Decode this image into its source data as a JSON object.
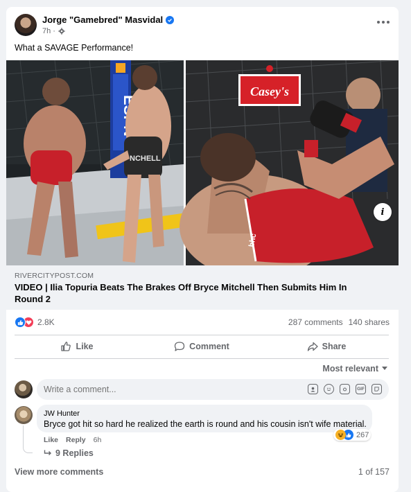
{
  "post": {
    "author": "Jorge \"Gamebred\" Masvidal",
    "time": "7h",
    "text": "What a SAVAGE Performance!"
  },
  "media": {
    "sponsor_sign": "Casey's",
    "banner_left": "ESPN",
    "shorts_text": "NCHELL",
    "shorts_text_right": "bhc"
  },
  "link": {
    "domain": "RIVERCITYPOST.COM",
    "title": "VIDEO | Ilia Topuria Beats The Brakes Off Bryce Mitchell Then Submits Him In Round 2"
  },
  "stats": {
    "reactions": "2.8K",
    "comments": "287 comments",
    "shares": "140 shares"
  },
  "actions": {
    "like": "Like",
    "comment": "Comment",
    "share": "Share"
  },
  "comments_sort": "Most relevant",
  "composer": {
    "placeholder": "Write a comment...",
    "gif_label": "GIF"
  },
  "comment": {
    "author": "JW Hunter",
    "text": "Bryce got hit so hard he realized the earth is round and his cousin isn't wife material.",
    "like": "Like",
    "reply": "Reply",
    "time": "6h",
    "reaction_count": "267",
    "replies": "9 Replies"
  },
  "footer": {
    "view_more": "View more comments",
    "pagination": "1 of 157"
  },
  "colors": {
    "accent": "#1877f2",
    "love": "#f33e58",
    "haha": "#f7b125",
    "muted": "#65676b"
  }
}
